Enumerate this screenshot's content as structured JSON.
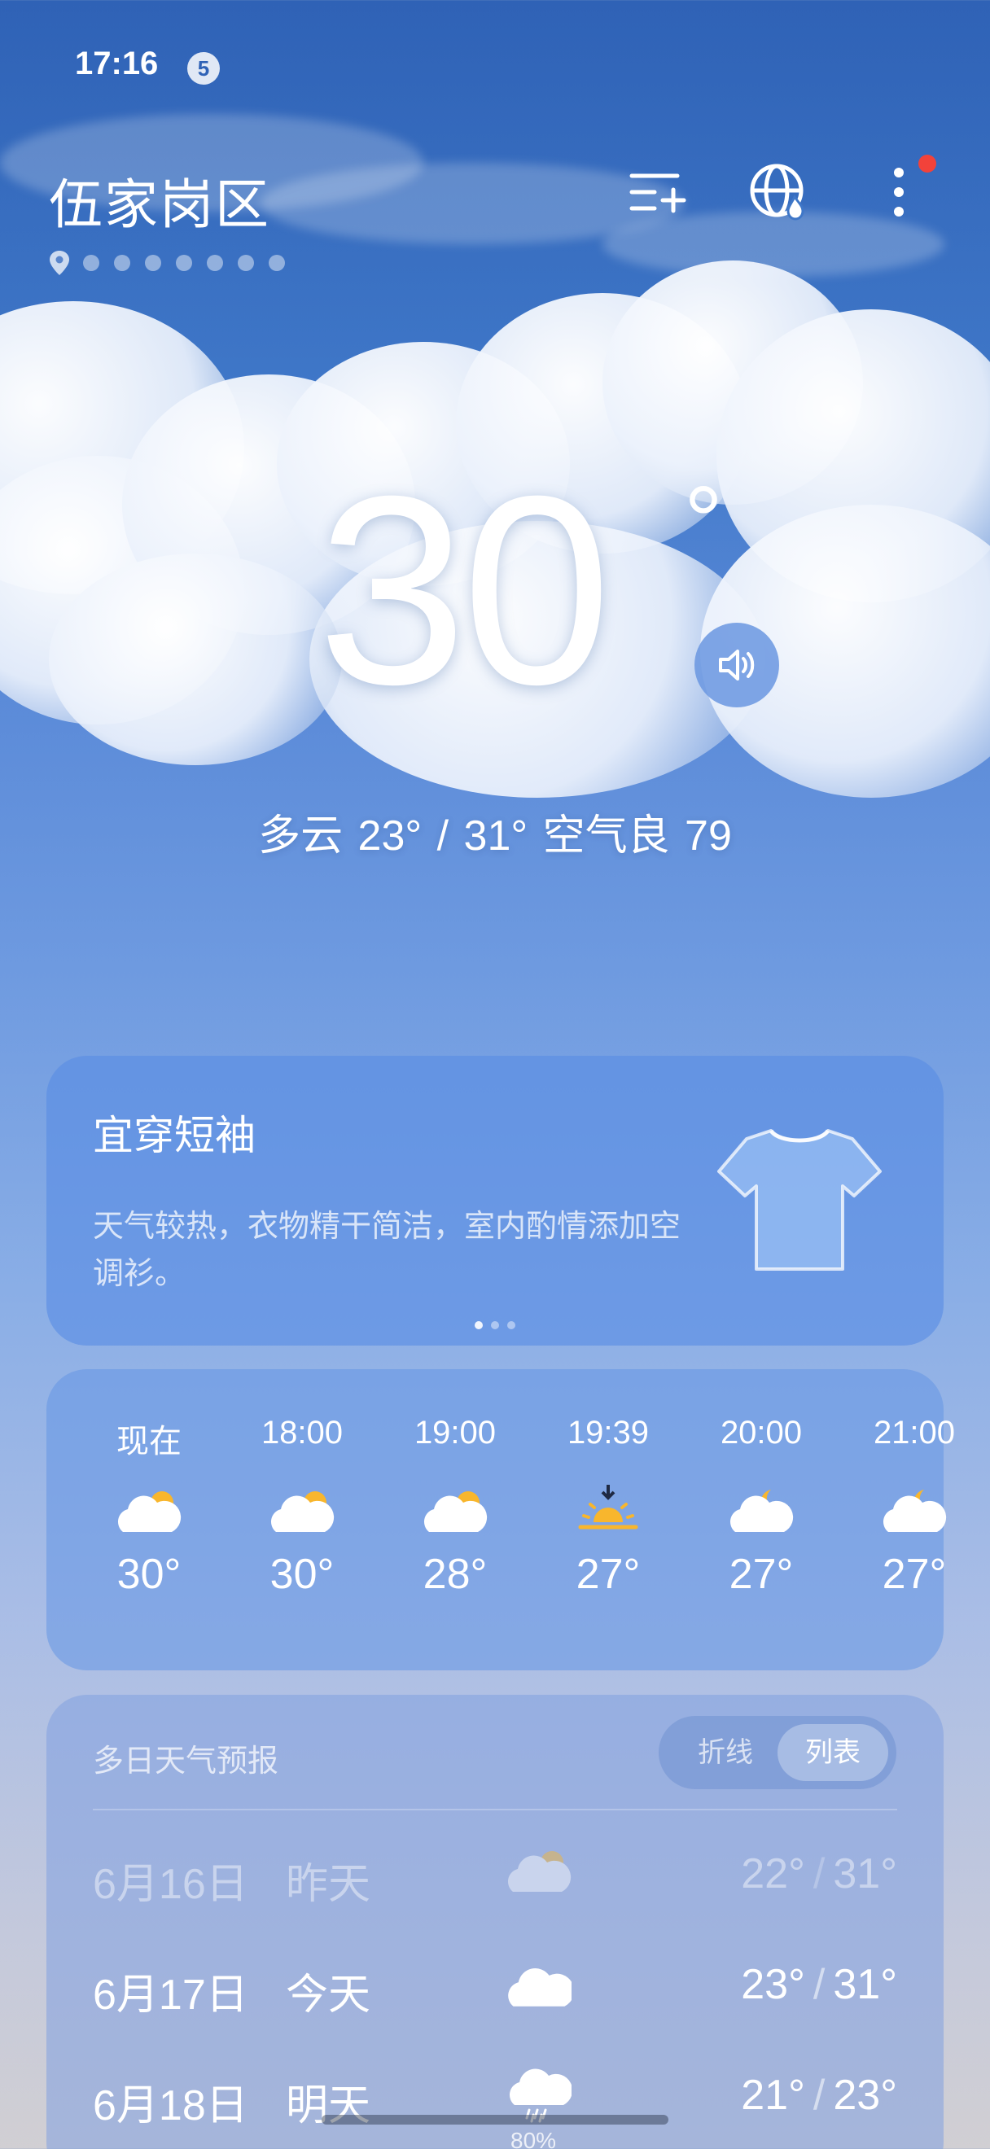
{
  "status_bar": {
    "time": "17:16",
    "notification_count": "5"
  },
  "header": {
    "city": "伍家岗区",
    "page_count": 7,
    "icons": [
      "add-city-icon",
      "globe-weather-icon",
      "more-icon"
    ]
  },
  "current": {
    "temperature": "30",
    "degree_symbol": "°",
    "summary": "多云  23° / 31°  空气良 79"
  },
  "clothing": {
    "title": "宜穿短袖",
    "description": "天气较热，衣物精干简洁，室内酌情添加空调衫。",
    "carousel_pages": 3,
    "active_page": 1
  },
  "hourly": [
    {
      "time": "现在",
      "icon": "partly-cloudy-day-icon",
      "temp": "30°"
    },
    {
      "time": "18:00",
      "icon": "partly-cloudy-day-icon",
      "temp": "30°"
    },
    {
      "time": "19:00",
      "icon": "partly-cloudy-day-icon",
      "temp": "28°"
    },
    {
      "time": "19:39",
      "icon": "sunset-icon",
      "temp": "27°"
    },
    {
      "time": "20:00",
      "icon": "partly-cloudy-night-icon",
      "temp": "27°"
    },
    {
      "time": "21:00",
      "icon": "partly-cloudy-night-icon",
      "temp": "27°"
    }
  ],
  "daily": {
    "title": "多日天气预报",
    "toggle_off": "折线",
    "toggle_on": "列表",
    "rows": [
      {
        "date": "6月16日",
        "label": "昨天",
        "icon": "partly-cloudy-day-icon",
        "low": "22°",
        "high": "31°",
        "past": true
      },
      {
        "date": "6月17日",
        "label": "今天",
        "icon": "cloudy-icon",
        "low": "23°",
        "high": "31°",
        "past": false
      },
      {
        "date": "6月18日",
        "label": "明天",
        "icon": "rain-icon",
        "low": "21°",
        "high": "23°",
        "precip": "80%",
        "past": false
      }
    ]
  },
  "colors": {
    "sky_top": "#2f62b6",
    "sky_bottom": "#d1cfd3",
    "notification_dot": "#f2423a",
    "sun": "#f8b62d"
  }
}
